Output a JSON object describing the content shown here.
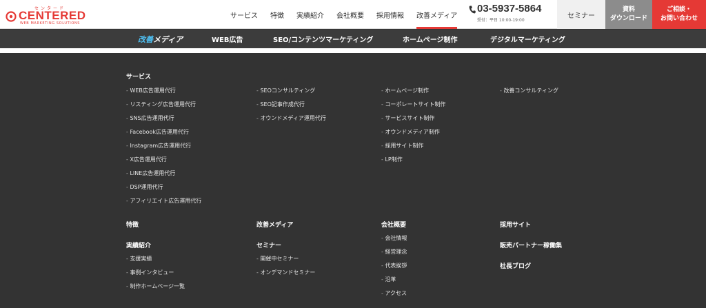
{
  "header": {
    "logo": {
      "kana": "センタード",
      "name": "CENTERED",
      "tagline": "WEB MARKETING SOLUTIONS"
    },
    "nav": [
      {
        "label": "サービス"
      },
      {
        "label": "特徴"
      },
      {
        "label": "実績紹介"
      },
      {
        "label": "会社概要"
      },
      {
        "label": "採用情報"
      },
      {
        "label": "改善メディア",
        "active": true
      }
    ],
    "tel": {
      "number": "03-5937-5864",
      "hours": "受付：平日 10:00-19:00"
    },
    "seminar_label": "セミナー",
    "download": {
      "line1": "資料",
      "line2": "ダウンロード"
    },
    "contact": {
      "line1": "ご相談・",
      "line2": "お問い合わせ"
    }
  },
  "subnav": {
    "logo": {
      "part1": "改善",
      "part2": "メディア"
    },
    "items": [
      "WEB広告",
      "SEO/コンテンツマーケティング",
      "ホームページ制作",
      "デジタルマーケティング"
    ]
  },
  "sitemap": {
    "service": {
      "title": "サービス",
      "col1": [
        "WEB広告運用代行",
        "リスティング広告運用代行",
        "SNS広告運用代行",
        "Facebook広告運用代行",
        "Instagram広告運用代行",
        "X広告運用代行",
        "LINE広告運用代行",
        "DSP運用代行",
        "アフィリエイト広告運用代行"
      ],
      "col2": [
        "SEOコンサルティング",
        "SEO記事作成代行",
        "オウンドメディア運用代行"
      ],
      "col3": [
        "ホームページ制作",
        "コーポレートサイト制作",
        "サービスサイト制作",
        "オウンドメディア制作",
        "採用サイト制作",
        "LP制作"
      ],
      "col4": [
        "改善コンサルティング"
      ]
    },
    "features": "特徴",
    "cases": {
      "title": "実績紹介",
      "items": [
        "支援実績",
        "事例インタビュー",
        "制作ホームページ一覧"
      ]
    },
    "media": "改善メディア",
    "seminar": {
      "title": "セミナー",
      "items": [
        "開催中セミナー",
        "オンデマンドセミナー"
      ]
    },
    "company": {
      "title": "会社概要",
      "items": [
        "会社情報",
        "経営理念",
        "代表挨拶",
        "沿革",
        "アクセス"
      ]
    },
    "recruit": "採用サイト",
    "partner": "販売パートナー稼働集",
    "blog": "社長ブログ"
  },
  "colors": {
    "brand_red": "#e53935",
    "dark_bg": "#333333",
    "subnav_bg": "#3c3c3c"
  }
}
